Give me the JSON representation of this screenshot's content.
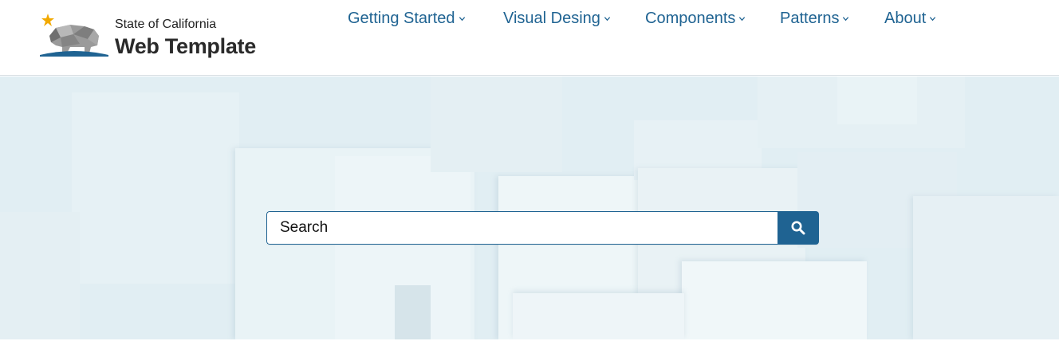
{
  "brand": {
    "small_text": "State of California",
    "large_text": "Web Template",
    "logo_icon": "california-bear-logo-icon",
    "star_color": "#f2a900",
    "underline_color": "#1f6392"
  },
  "nav": {
    "items": [
      {
        "label": "Getting Started",
        "icon": "chevron-down-icon"
      },
      {
        "label": "Visual Desing",
        "icon": "chevron-down-icon"
      },
      {
        "label": "Components",
        "icon": "chevron-down-icon"
      },
      {
        "label": "Patterns",
        "icon": "chevron-down-icon"
      },
      {
        "label": "About",
        "icon": "chevron-down-icon"
      }
    ],
    "color": "#1f6392"
  },
  "search": {
    "placeholder": "Search",
    "button_icon": "search-icon",
    "accent": "#1f6392"
  },
  "hero": {
    "background": "#e1eef3"
  }
}
